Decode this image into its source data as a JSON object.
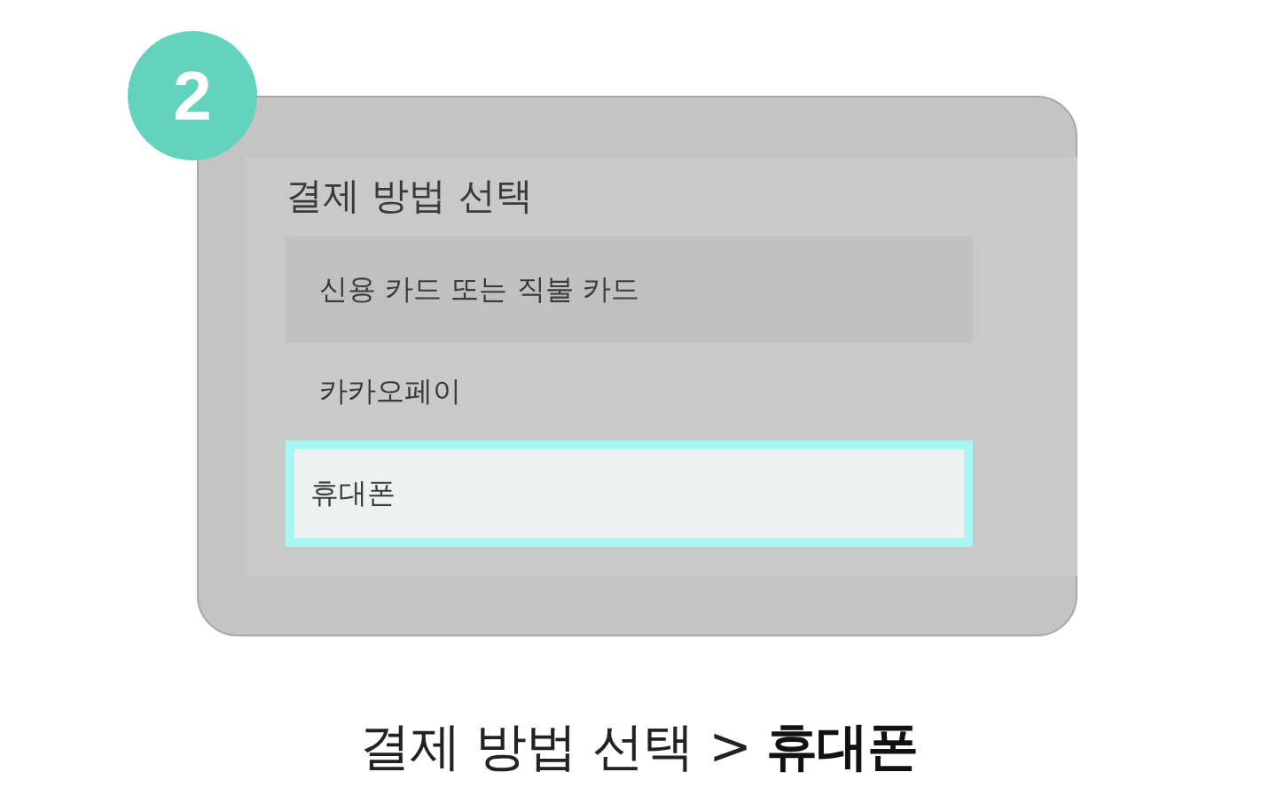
{
  "step_badge": "2",
  "dialog": {
    "title": "결제 방법 선택",
    "options": [
      {
        "label": "신용 카드 또는 직불 카드",
        "hovered": true,
        "selected": false
      },
      {
        "label": "카카오페이",
        "hovered": false,
        "selected": false
      },
      {
        "label": "휴대폰",
        "hovered": false,
        "selected": true
      }
    ]
  },
  "caption": "결제 방법 선택 > **휴대폰**"
}
